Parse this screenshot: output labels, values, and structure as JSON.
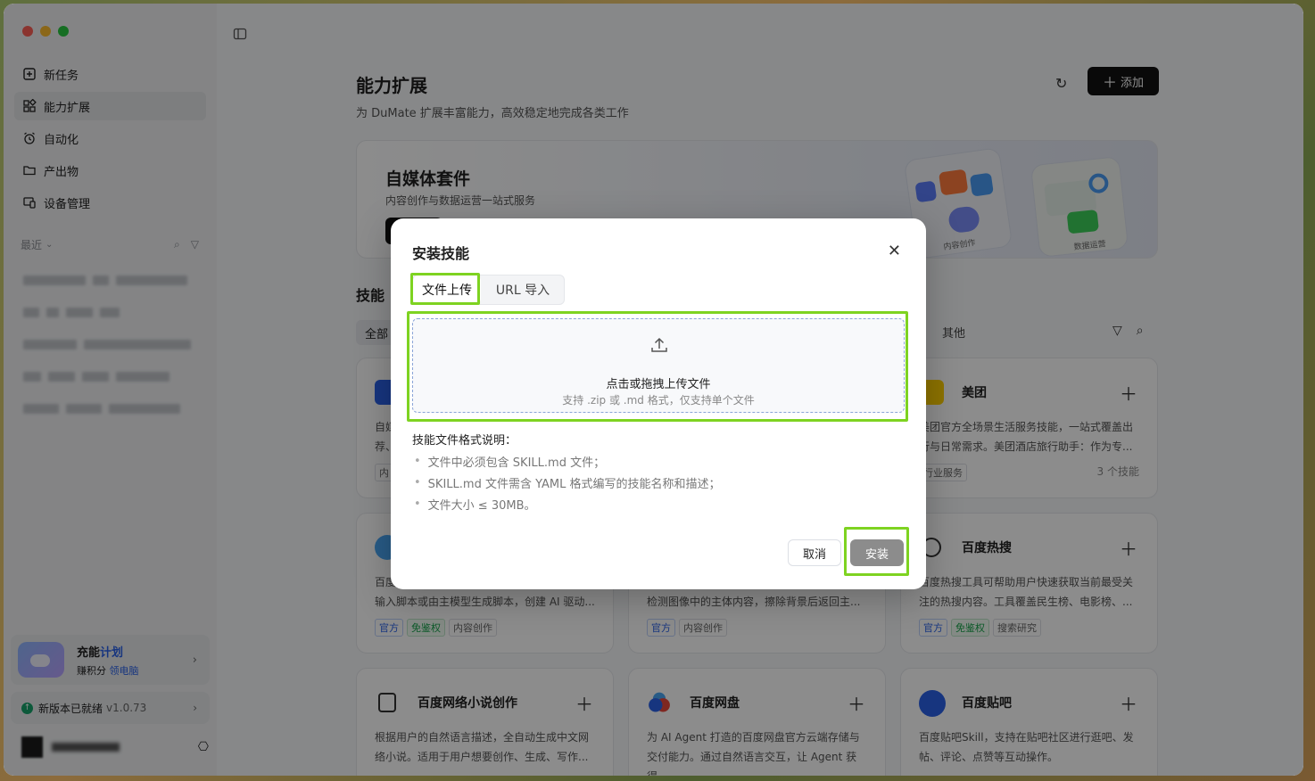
{
  "sidebar": {
    "nav": [
      {
        "label": "新任务",
        "icon": "new-task-icon"
      },
      {
        "label": "能力扩展",
        "icon": "extensions-icon"
      },
      {
        "label": "自动化",
        "icon": "alarm-clock-icon"
      },
      {
        "label": "产出物",
        "icon": "folder-icon"
      },
      {
        "label": "设备管理",
        "icon": "devices-icon"
      }
    ],
    "recent_label": "最近",
    "promo": {
      "title_a": "充能",
      "title_b": "计划",
      "sub_a": "赚积分",
      "sub_b": "领电脑"
    },
    "update": {
      "label": "新版本已就绪",
      "version": "v1.0.73"
    }
  },
  "main": {
    "title": "能力扩展",
    "subtitle": "为 DuMate 扩展丰富能力，高效稳定地完成各类工作",
    "add_label": "添加",
    "banner": {
      "title": "自媒体套件",
      "subtitle": "内容创作与数据运营一站式服务",
      "art_label_1": "内容创作",
      "art_label_2": "数据运营"
    },
    "skills_label": "技能",
    "filter_all": "全部",
    "filter_other": "其他",
    "cards": [
      {
        "name": "",
        "desc": "自媒\n荐、",
        "tags": [
          "内"
        ]
      },
      {
        "name": "美团",
        "desc": "美团官方全场景生活服务技能，一站式覆盖出行与日常需求。美团酒店旅行助手：作为专...",
        "tags": [
          "行业服务"
        ],
        "count": "3 个技能"
      },
      {
        "name": "",
        "desc": "百度\n输入脚本或由主模型生成脚本，创建 AI 驱动...",
        "tags": [
          "官方",
          "免鉴权",
          "内容创作"
        ]
      },
      {
        "name": "",
        "desc": "\n检测图像中的主体内容，擦除背景后返回主...",
        "tags": [
          "官方",
          "内容创作"
        ]
      },
      {
        "name": "百度热搜",
        "desc": "百度热搜工具可帮助用户快速获取当前最受关注的热搜内容。工具覆盖民生榜、电影榜、...",
        "tags": [
          "官方",
          "免鉴权",
          "搜索研究"
        ]
      },
      {
        "name": "百度网络小说创作",
        "desc": "根据用户的自然语言描述，全自动生成中文网络小说。适用于用户想要创作、生成、写作...",
        "tags": []
      },
      {
        "name": "百度网盘",
        "desc": "为 AI Agent 打造的百度网盘官方云端存储与交付能力。通过自然语言交互，让 Agent 获得...",
        "tags": []
      },
      {
        "name": "百度贴吧",
        "desc": "百度贴吧Skill，支持在贴吧社区进行逛吧、发帖、评论、点赞等互动操作。",
        "tags": []
      }
    ]
  },
  "dialog": {
    "title": "安装技能",
    "tab_upload": "文件上传",
    "tab_url": "URL 导入",
    "drop_title": "点击或拖拽上传文件",
    "drop_hint": "支持 .zip 或 .md 格式，仅支持单个文件",
    "format_title": "技能文件格式说明：",
    "format_items": [
      "文件中必须包含 SKILL.md 文件；",
      "SKILL.md 文件需含 YAML 格式编写的技能名称和描述；",
      "文件大小 ≤ 30MB。"
    ],
    "cancel_label": "取消",
    "install_label": "安装"
  },
  "colors": {
    "accent": "#2a62e8",
    "highlight": "#7ed321",
    "primary_button": "#111111",
    "install_disabled": "#8c8c8c"
  }
}
